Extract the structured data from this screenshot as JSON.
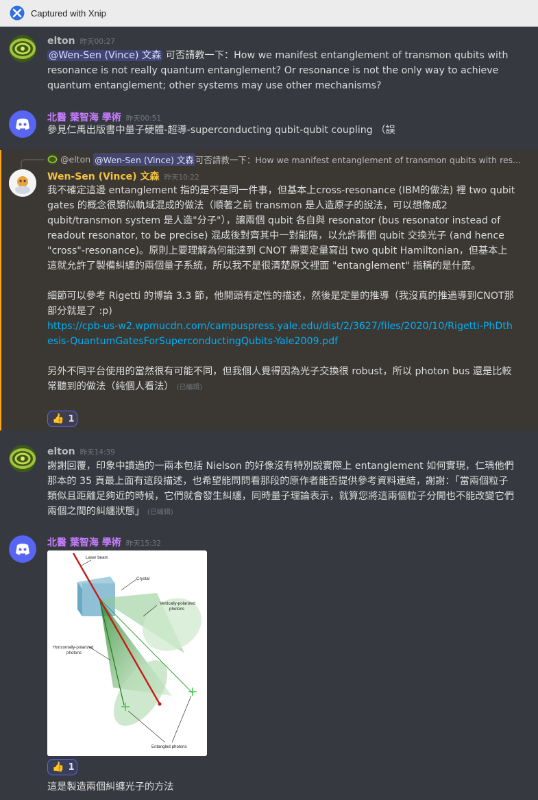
{
  "window": {
    "title": "Captured with Xnip"
  },
  "colors": {
    "bot_name": "#c77dff",
    "vince_name": "#f5c242",
    "mention_bg": "#4e5598",
    "link": "#00aff4"
  },
  "messages": [
    {
      "user": "elton",
      "time": "昨天00:27",
      "mention": "@Wen-Sen (Vince) 文森",
      "text": " 可否請教一下：How we manifest entanglement of transmon qubits with resonance is not really quantum entanglement? Or resonance is not the only way to achieve quantum entanglement; other systems may use other mechanisms?"
    },
    {
      "user": "北醫 葉智海 學術",
      "time": "昨天00:51",
      "text": "參見仁禹出版書中量子硬體-超導-superconducting qubit-qubit coupling （誤"
    },
    {
      "reply": {
        "user": "@elton",
        "mention": "@Wen-Sen (Vince) 文森",
        "text": " 可否請教一下：How we manifest entanglement of transmon qubits with res..."
      },
      "user": "Wen-Sen (Vince) 文森",
      "time": "昨天10:22",
      "p1": "我不確定這邊 entanglement 指的是不是同一件事，但基本上cross-resonance (IBM的做法) 裡 two qubit gates 的概念很類似軌域混成的做法（順著之前 transmon 是人造原子的說法，可以想像成2 qubit/transmon system 是人造\"分子\"），讓兩個 qubit 各自與 resonator (bus resonator instead of readout resonator, to be precise) 混成後對齊其中一對能階，以允許兩個 qubit 交換光子 (and hence \"cross\"-resonance)。原則上要理解為何能達到 CNOT 需要定量寫出 two qubit Hamiltonian，但基本上這就允許了製備糾纏的兩個量子系統，所以我不是很清楚原文裡面 \"entanglement\" 指稱的是什麼。",
      "p2": "細節可以參考 Rigetti 的博論 3.3 節，他開頭有定性的描述，然後是定量的推導（我沒真的推過導到CNOT那部分就是了 :p)",
      "link": "https://cpb-us-w2.wpmucdn.com/campuspress.yale.edu/dist/2/3627/files/2020/10/Rigetti-PhDthesis-QuantumGatesForSuperconductingQubits-Yale2009.pdf",
      "p3": "另外不同平台使用的當然很有可能不同，但我個人覺得因為光子交換很 robust，所以 photon bus 還是比較常聽到的做法（純個人看法）",
      "edited": "(已编辑)",
      "reaction": {
        "emoji": "👍",
        "count": "1"
      }
    },
    {
      "user": "elton",
      "time": "昨天14:39",
      "text": "謝謝回覆，印象中讀過的一兩本包括 Nielson 的好像沒有特別說實際上 entanglement 如何實現，仁瑀他們那本的 35 頁最上面有這段描述，也希望能問問看那段的原作者能否提供參考資料連結，謝謝：「當兩個粒子類似且距離足夠近的時候，它們就會發生糾纏，同時量子理論表示，就算您將這兩個粒子分開也不能改變它們兩個之間的糾纏狀態」",
      "edited": "(已编辑)"
    },
    {
      "user": "北醫 葉智海 學術",
      "time": "昨天15:32",
      "figure": {
        "laser": "Laser beam",
        "crystal": "Crystal",
        "vertical": "Vertically-polarized photons",
        "horizontal": "Horizontally-polarized photons",
        "entangled": "Entangled photons"
      },
      "reaction": {
        "emoji": "👍",
        "count": "1"
      },
      "text": "這是製造兩個糾纏光子的方法"
    }
  ]
}
